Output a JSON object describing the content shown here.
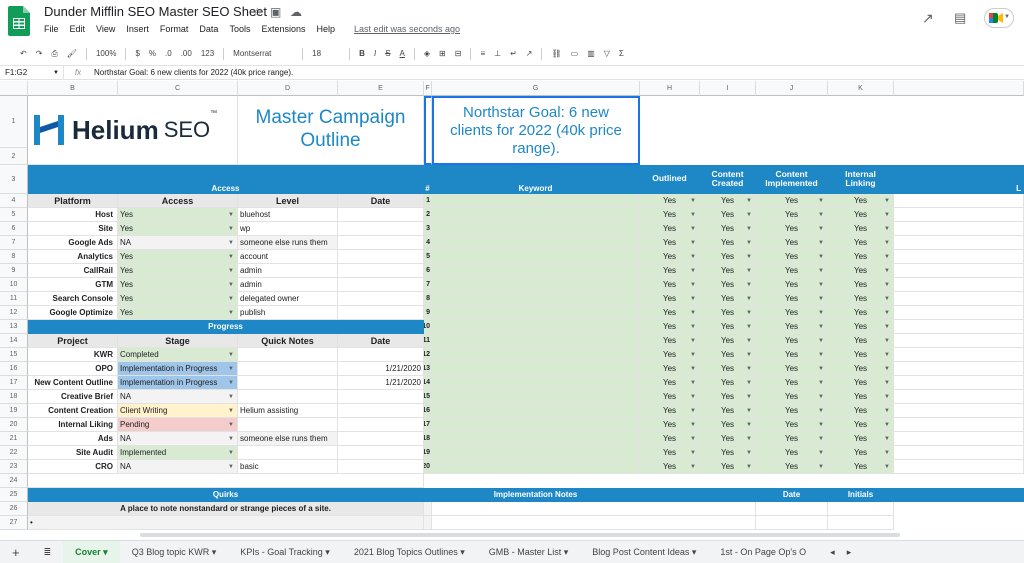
{
  "app": {
    "title": "Dunder Mifflin SEO Master SEO Sheet",
    "last_edit": "Last edit was seconds ago",
    "menu": [
      "File",
      "Edit",
      "View",
      "Insert",
      "Format",
      "Data",
      "Tools",
      "Extensions",
      "Help"
    ]
  },
  "toolbar": {
    "zoom": "100%",
    "currency": "$",
    "percent": "%",
    "dec_less": ".0",
    "dec_more": ".00",
    "format123": "123",
    "font": "Montserrat",
    "size": "18"
  },
  "formula": {
    "namebox": "F1:G2",
    "fx": "fx",
    "text": "Northstar Goal: 6 new clients for 2022 (40k price range)."
  },
  "columns": [
    "B",
    "C",
    "D",
    "E",
    "F",
    "G",
    "H",
    "I",
    "J",
    "K"
  ],
  "rows": [
    "1",
    "2",
    "3",
    "4",
    "5",
    "6",
    "7",
    "8",
    "9",
    "10",
    "11",
    "12",
    "13",
    "14",
    "15",
    "16",
    "17",
    "18",
    "19",
    "20",
    "21",
    "22",
    "23",
    "24",
    "25",
    "26",
    "27"
  ],
  "brand": {
    "name": "Helium",
    "seo": "SEO",
    "tm": "™"
  },
  "header": {
    "campaign": "Master Campaign Outline",
    "northstar": "Northstar Goal: 6 new clients for 2022 (40k price range)."
  },
  "access": {
    "title": "Access",
    "cols": [
      "Platform",
      "Access",
      "Level",
      "Date"
    ],
    "rows": [
      [
        "Host",
        "Yes",
        "bluehost",
        ""
      ],
      [
        "Site",
        "Yes",
        "wp",
        ""
      ],
      [
        "Google Ads",
        "NA",
        "someone else runs them",
        ""
      ],
      [
        "Analytics",
        "Yes",
        "account",
        ""
      ],
      [
        "CallRail",
        "Yes",
        "admin",
        ""
      ],
      [
        "GTM",
        "Yes",
        "admin",
        ""
      ],
      [
        "Search Console",
        "Yes",
        "delegated owner",
        ""
      ],
      [
        "Google Optimize",
        "Yes",
        "publish",
        ""
      ]
    ]
  },
  "progress": {
    "title": "Progress",
    "cols": [
      "Project",
      "Stage",
      "Quick Notes",
      "Date"
    ],
    "rows": [
      [
        "KWR",
        "Completed",
        "",
        ""
      ],
      [
        "OPO",
        "Implementation in Progress",
        "",
        "1/21/2020"
      ],
      [
        "New Content Outline",
        "Implementation in Progress",
        "",
        "1/21/2020"
      ],
      [
        "Creative Brief",
        "NA",
        "",
        ""
      ],
      [
        "Content Creation",
        "Client Writing",
        "Helium assisting",
        ""
      ],
      [
        "Internal Liking",
        "Pending",
        "",
        ""
      ],
      [
        "Ads",
        "NA",
        "someone else runs them",
        ""
      ],
      [
        "Site Audit",
        "Implemented",
        "",
        ""
      ],
      [
        "CRO",
        "NA",
        "basic",
        ""
      ]
    ]
  },
  "quirks": {
    "title": "Quirks",
    "subtitle": "A place to note nonstandard or strange pieces of a site.",
    "bullet": "•"
  },
  "keywords": {
    "hash": "#",
    "keyword": "Keyword",
    "outlined": "Outlined",
    "created": "Content Created",
    "implemented": "Content Implemented",
    "linking": "Internal Linking",
    "extra": "L",
    "nums": [
      "1",
      "2",
      "3",
      "4",
      "5",
      "6",
      "7",
      "8",
      "9",
      "10",
      "11",
      "12",
      "13",
      "14",
      "15",
      "16",
      "17",
      "18",
      "19",
      "20"
    ],
    "yes": "Yes"
  },
  "impl": {
    "notes": "Implementation Notes",
    "date": "Date",
    "initials": "Initials"
  },
  "tabs": [
    "Cover",
    "Q3 Blog topic KWR",
    "KPIs - Goal Tracking",
    "2021 Blog Topics Outlines",
    "GMB - Master List",
    "Blog Post Content Ideas",
    "1st - On Page Op's O"
  ]
}
